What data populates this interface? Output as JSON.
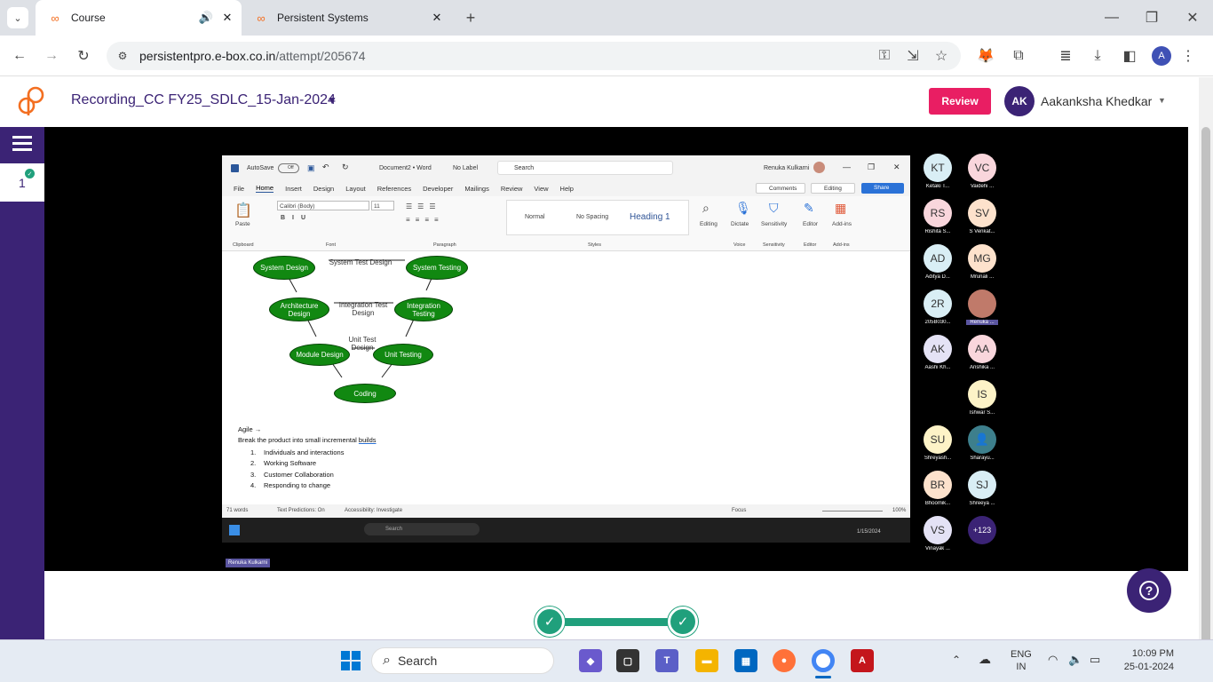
{
  "browser": {
    "tabs": [
      {
        "title": "Course",
        "active": true
      },
      {
        "title": "Persistent Systems",
        "active": false
      }
    ],
    "url_host": "persistentpro.e-box.co.in",
    "url_path": "/attempt/205674",
    "profile_initial": "A"
  },
  "app": {
    "title": "Recording_CC FY25_SDLC_15-Jan-2024",
    "review_label": "Review",
    "user_initials": "AK",
    "user_name": "Aakanksha Khedkar",
    "progress_number": "1",
    "help_icon": "question-icon",
    "accent_color": "#3b2375",
    "review_color": "#e91e63",
    "progress_color": "#20a07c"
  },
  "word": {
    "autosave": "AutoSave",
    "autosave_state": "Off",
    "doc_name": "Document2 • Word",
    "no_label": "No Label",
    "search": "Search",
    "user": "Renuka Kulkarni",
    "menu": [
      "File",
      "Home",
      "Insert",
      "Design",
      "Layout",
      "References",
      "Developer",
      "Mailings",
      "Review",
      "View",
      "Help"
    ],
    "comments": "Comments",
    "editing": "Editing",
    "share": "Share",
    "font": "Calibri (Body)",
    "font_size": "11",
    "paste": "Paste",
    "styles": [
      "Normal",
      "No Spacing",
      "Heading 1"
    ],
    "ribbon_groups": [
      "Clipboard",
      "Font",
      "Paragraph",
      "Styles",
      "Voice",
      "Sensitivity",
      "Editor",
      "Add-ins"
    ],
    "ribbon_buttons": [
      "Editing",
      "Dictate",
      "Sensitivity",
      "Editor",
      "Add-ins"
    ],
    "diagram": {
      "nodes": [
        "System Design",
        "System Testing",
        "Architecture Design",
        "Integration Testing",
        "Module Design",
        "Unit Testing",
        "Coding"
      ],
      "links": [
        "System Test Design",
        "Integration Test Design",
        "Unit Test Design"
      ]
    },
    "body": {
      "heading": "Agile →",
      "line": "Break the product into small incremental ",
      "line_link": "builds",
      "list": [
        {
          "num": "1.",
          "text": "Individuals and interactions"
        },
        {
          "num": "2.",
          "text": "Working Software"
        },
        {
          "num": "3.",
          "text": "Customer Collaboration"
        },
        {
          "num": "4.",
          "text": "Responding to change"
        }
      ]
    },
    "status": {
      "words": "71 words",
      "predictions": "Text Predictions: On",
      "accessibility": "Accessibility: Investigate",
      "focus": "Focus",
      "zoom": "100%"
    },
    "taskbar_search": "Search",
    "taskbar_date": "1/15/2024"
  },
  "speaker_label": "Renuka Kulkarni",
  "participants": [
    {
      "initials": "KT",
      "name": "Ketaki T...",
      "color": "#d9eef5"
    },
    {
      "initials": "VC",
      "name": "Vaidehi ...",
      "color": "#f9d6dc"
    },
    {
      "initials": "RS",
      "name": "Rishita S...",
      "color": "#f9d6dc"
    },
    {
      "initials": "SV",
      "name": "S Venkat...",
      "color": "#fde2cc"
    },
    {
      "initials": "AD",
      "name": "Aditya D...",
      "color": "#d9eef5"
    },
    {
      "initials": "MG",
      "name": "Mrunali ...",
      "color": "#fde2cc"
    },
    {
      "initials": "2R",
      "name": "205B030...",
      "color": "#d9eef5"
    },
    {
      "initials": "",
      "name": "Renuka ...",
      "color": "#c07a6a"
    },
    {
      "initials": "AK",
      "name": "Aashi Kh...",
      "color": "#e4e2f5"
    },
    {
      "initials": "AA",
      "name": "Anshika ...",
      "color": "#f9d6dc"
    },
    {
      "initials": "IS",
      "name": "Ishwar S...",
      "color": "#fdf3c7"
    },
    {
      "initials": "SU",
      "name": "Shreyash...",
      "color": "#fdf3c7"
    },
    {
      "initials": "",
      "name": "Sharayu...",
      "color": "#3d7f8c"
    },
    {
      "initials": "BR",
      "name": "Bhoomik...",
      "color": "#fde2cc"
    },
    {
      "initials": "SJ",
      "name": "Shreeya ...",
      "color": "#d9eef5"
    },
    {
      "initials": "VS",
      "name": "Vinayak ...",
      "color": "#e4e2f5"
    },
    {
      "initials": "+123",
      "name": "",
      "color": "#3b2375"
    }
  ],
  "taskbar": {
    "search": "Search",
    "lang": "ENG",
    "region": "IN",
    "time": "10:09 PM",
    "date": "25-01-2024"
  }
}
